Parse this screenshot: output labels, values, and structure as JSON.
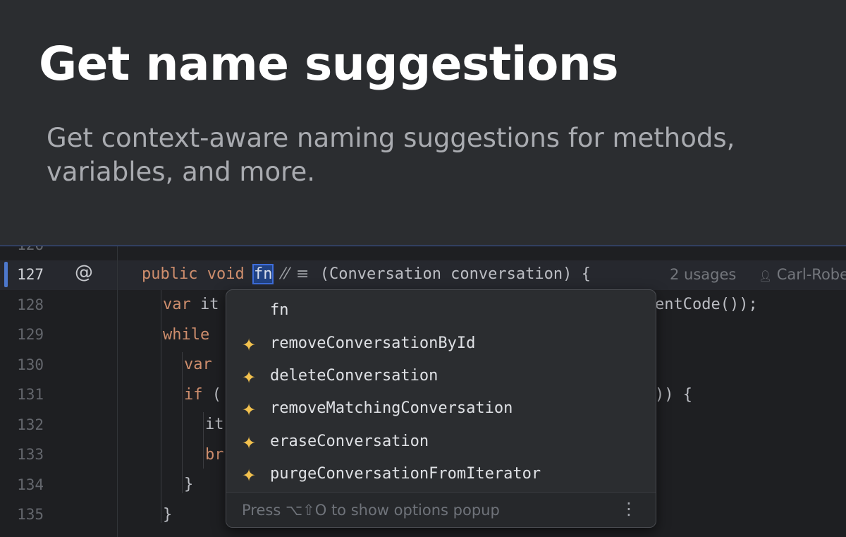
{
  "hero": {
    "title": "Get name suggestions",
    "subtitle": "Get context-aware naming suggestions for methods, variables, and more."
  },
  "editor": {
    "line_numbers": [
      "127",
      "128",
      "129",
      "130",
      "131",
      "132",
      "133",
      "134",
      "135"
    ],
    "current_line": "127",
    "gutter_icon": "@",
    "lines": {
      "l127": {
        "kw1": "public",
        "kw2": "void",
        "name": "fn",
        "ai_icons": "⁄⁄ ≡",
        "rest": "(Conversation conversation) {"
      },
      "l128": {
        "kw": "var",
        "text": "it",
        "tail": "entCode());"
      },
      "l129": {
        "kw": "while"
      },
      "l130": {
        "kw": "var"
      },
      "l131": {
        "kw": "if",
        "text": " (",
        "tail": ")) {"
      },
      "l132": {
        "text": "it"
      },
      "l133": {
        "kw": "br"
      },
      "l134": {
        "text": "}"
      },
      "l135": {
        "text": "}"
      }
    },
    "inlay": {
      "usages": "2 usages",
      "author": "Carl-Robe"
    }
  },
  "popup": {
    "items": [
      {
        "label": "fn",
        "icon": ""
      },
      {
        "label": "removeConversationById",
        "icon": "sparkle-icon"
      },
      {
        "label": "deleteConversation",
        "icon": "sparkle-icon"
      },
      {
        "label": "removeMatchingConversation",
        "icon": "sparkle-icon"
      },
      {
        "label": "eraseConversation",
        "icon": "sparkle-icon"
      },
      {
        "label": "purgeConversationFromIterator",
        "icon": "sparkle-icon"
      }
    ],
    "footer_hint": "Press ⌥⇧O to show options popup",
    "more_icon": "⋮"
  },
  "colors": {
    "keyword": "#cf8e6d",
    "sparkle": "#f2c14e",
    "selection": "#214283"
  }
}
